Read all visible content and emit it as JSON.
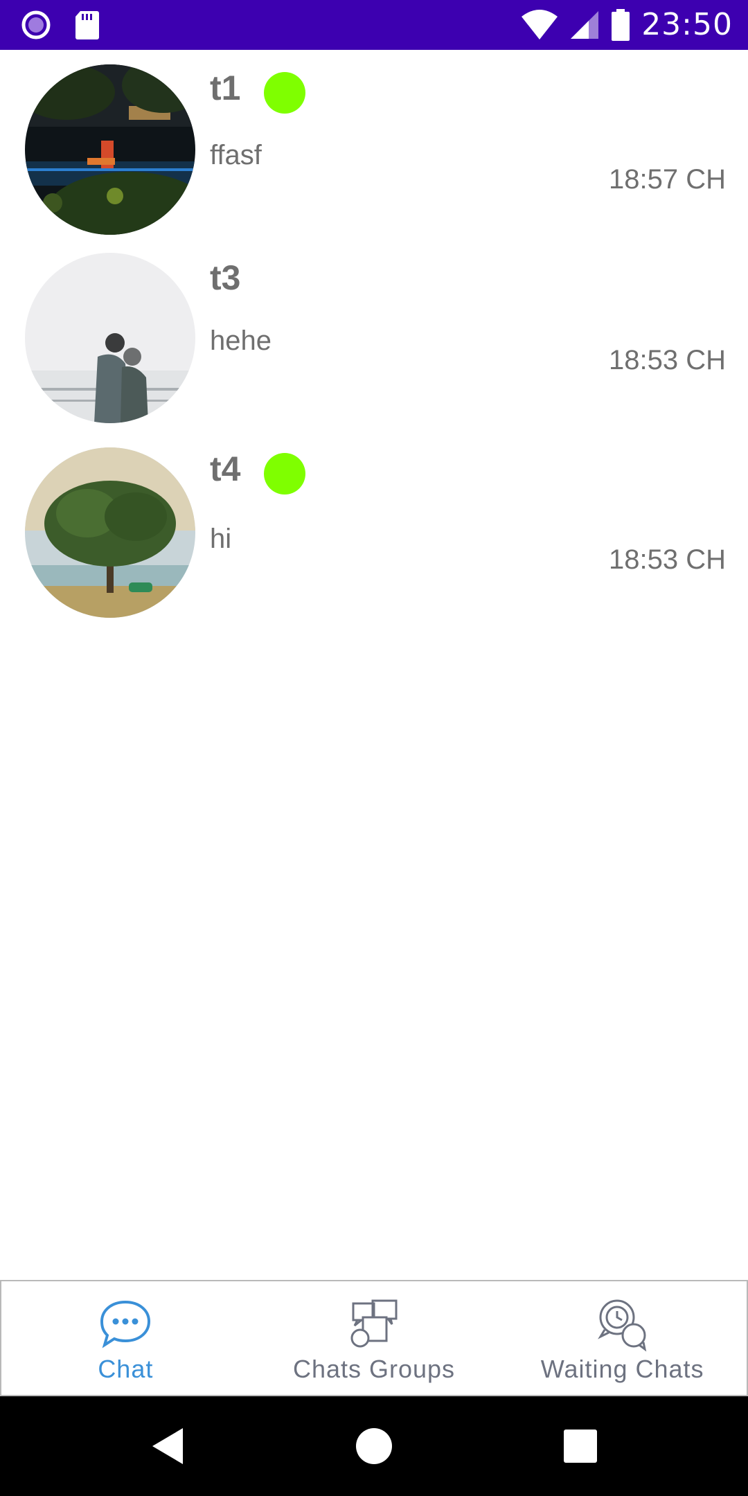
{
  "status_bar": {
    "time": "23:50",
    "icons": [
      "record-icon",
      "sd-card-icon",
      "wifi-icon",
      "signal-icon",
      "battery-icon"
    ]
  },
  "chats": [
    {
      "name": "t1",
      "message": "ffasf",
      "time": "18:57 CH",
      "online": true,
      "avatar": "night-lake-photo"
    },
    {
      "name": "t3",
      "message": "hehe",
      "time": "18:53 CH",
      "online": false,
      "avatar": "couple-photo"
    },
    {
      "name": "t4",
      "message": "hi",
      "time": "18:53 CH",
      "online": true,
      "avatar": "tree-photo"
    }
  ],
  "bottom_nav": {
    "items": [
      {
        "label": "Chat",
        "icon": "chat-bubble-icon",
        "active": true
      },
      {
        "label": "Chats Groups",
        "icon": "group-chats-icon",
        "active": false
      },
      {
        "label": "Waiting Chats",
        "icon": "waiting-chats-icon",
        "active": false
      }
    ]
  },
  "colors": {
    "status_bar": "#3d00b0",
    "online": "#7fff00",
    "active_nav": "#3a90d8",
    "inactive_nav": "#6d7280",
    "text": "#6f6f6f"
  }
}
